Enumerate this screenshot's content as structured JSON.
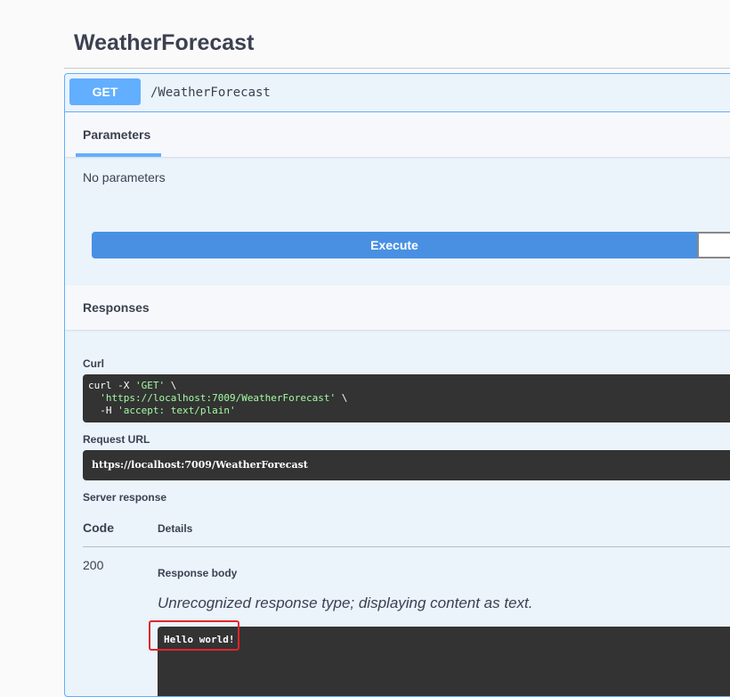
{
  "tag": {
    "title": "WeatherForecast"
  },
  "operation": {
    "method": "GET",
    "path": "/WeatherForecast"
  },
  "parameters": {
    "tab_label": "Parameters",
    "empty_text": "No parameters"
  },
  "execute_label": "Execute",
  "responses": {
    "header": "Responses",
    "curl_label": "Curl",
    "curl_lines": {
      "l1_cmd": "curl -X ",
      "l1_str": "'GET'",
      "l1_end": " \\",
      "l2_str": "'https://localhost:7009/WeatherForecast'",
      "l2_end": " \\",
      "l3_cmd": "  -H ",
      "l3_str": "'accept: text/plain'"
    },
    "request_url_label": "Request URL",
    "request_url": "https://localhost:7009/WeatherForecast",
    "server_response_label": "Server response",
    "code_header": "Code",
    "details_header": "Details",
    "status_code": "200",
    "response_body_label": "Response body",
    "unrecognized_text": "Unrecognized response type; displaying content as text.",
    "body_text": "Hello world!"
  },
  "colors": {
    "get_accent": "#61affe",
    "execute": "#4990e2",
    "highlight": "#e0262b"
  }
}
